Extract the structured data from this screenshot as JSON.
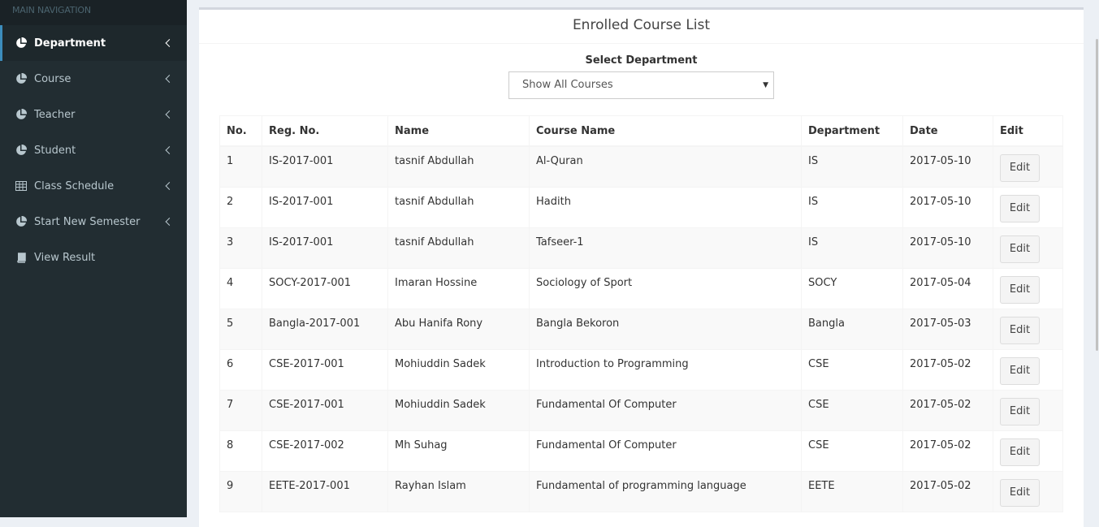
{
  "sidebar": {
    "header": "MAIN NAVIGATION",
    "items": [
      {
        "label": "Department",
        "icon": "pie-chart-icon"
      },
      {
        "label": "Course",
        "icon": "pie-chart-icon"
      },
      {
        "label": "Teacher",
        "icon": "pie-chart-icon"
      },
      {
        "label": "Student",
        "icon": "pie-chart-icon"
      },
      {
        "label": "Class Schedule",
        "icon": "table-icon"
      },
      {
        "label": "Start New Semester",
        "icon": "pie-chart-icon"
      },
      {
        "label": "View Result",
        "icon": "book-icon"
      }
    ]
  },
  "main": {
    "title": "Enrolled Course List",
    "select_label": "Select Department",
    "select_value": "Show All Courses",
    "table": {
      "columns": [
        "No.",
        "Reg. No.",
        "Name",
        "Course Name",
        "Department",
        "Date",
        "Edit"
      ],
      "edit_label": "Edit",
      "rows": [
        [
          "1",
          "IS-2017-001",
          "tasnif Abdullah",
          "Al-Quran",
          "IS",
          "2017-05-10"
        ],
        [
          "2",
          "IS-2017-001",
          "tasnif Abdullah",
          "Hadith",
          "IS",
          "2017-05-10"
        ],
        [
          "3",
          "IS-2017-001",
          "tasnif Abdullah",
          "Tafseer-1",
          "IS",
          "2017-05-10"
        ],
        [
          "4",
          "SOCY-2017-001",
          "Imaran Hossine",
          "Sociology of Sport",
          "SOCY",
          "2017-05-04"
        ],
        [
          "5",
          "Bangla-2017-001",
          "Abu Hanifa Rony",
          "Bangla Bekoron",
          "Bangla",
          "2017-05-03"
        ],
        [
          "6",
          "CSE-2017-001",
          "Mohiuddin Sadek",
          "Introduction to Programming",
          "CSE",
          "2017-05-02"
        ],
        [
          "7",
          "CSE-2017-001",
          "Mohiuddin Sadek",
          "Fundamental Of Computer",
          "CSE",
          "2017-05-02"
        ],
        [
          "8",
          "CSE-2017-002",
          "Mh Suhag",
          "Fundamental Of Computer",
          "CSE",
          "2017-05-02"
        ],
        [
          "9",
          "EETE-2017-001",
          "Rayhan Islam",
          "Fundamental of programming language",
          "EETE",
          "2017-05-02"
        ]
      ]
    }
  },
  "colors": {
    "sidebar_bg": "#222d32",
    "active_accent": "#3c8dbc",
    "content_bg": "#ecf0f5"
  }
}
